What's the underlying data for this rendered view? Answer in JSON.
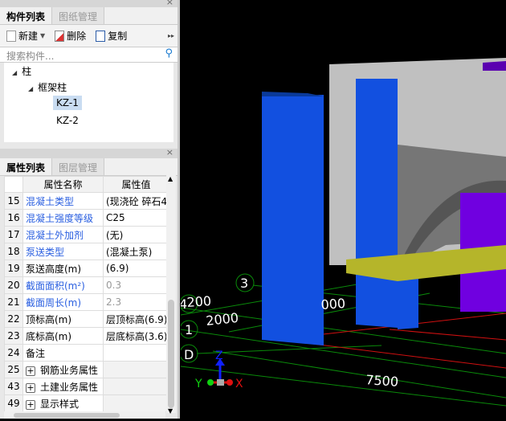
{
  "component_panel": {
    "close": "×",
    "tabs": [
      "构件列表",
      "图纸管理"
    ],
    "toolbar": {
      "new": "新建",
      "delete": "删除",
      "copy": "复制",
      "more": "▸▸"
    },
    "search_placeholder": "搜索构件...",
    "tree": {
      "root": "柱",
      "child": "框架柱",
      "items": [
        "KZ-1",
        "KZ-2"
      ],
      "selected": "KZ-1"
    }
  },
  "property_panel": {
    "close": "×",
    "tabs": [
      "属性列表",
      "图层管理"
    ],
    "headers": [
      "属性名称",
      "属性值"
    ],
    "rows": [
      {
        "no": "15",
        "name": "混凝土类型",
        "value": "(现浇砼 碎石4",
        "style": "blue"
      },
      {
        "no": "16",
        "name": "混凝土强度等级",
        "value": "C25",
        "style": "blue"
      },
      {
        "no": "17",
        "name": "混凝土外加剂",
        "value": "(无)",
        "style": "blue"
      },
      {
        "no": "18",
        "name": "泵送类型",
        "value": "(混凝土泵)",
        "style": "blue"
      },
      {
        "no": "19",
        "name": "泵送高度(m)",
        "value": "(6.9)",
        "style": "normal"
      },
      {
        "no": "20",
        "name": "截面面积(m²)",
        "value": "0.3",
        "style": "blue-gray"
      },
      {
        "no": "21",
        "name": "截面周长(m)",
        "value": "2.3",
        "style": "blue-gray"
      },
      {
        "no": "22",
        "name": "顶标高(m)",
        "value": "层顶标高(6.9)",
        "style": "normal"
      },
      {
        "no": "23",
        "name": "底标高(m)",
        "value": "层底标高(3.6)",
        "style": "normal"
      },
      {
        "no": "24",
        "name": "备注",
        "value": "",
        "style": "normal"
      },
      {
        "no": "25",
        "name": "钢筋业务属性",
        "value": "",
        "style": "group"
      },
      {
        "no": "43",
        "name": "土建业务属性",
        "value": "",
        "style": "group"
      },
      {
        "no": "49",
        "name": "显示样式",
        "value": "",
        "style": "group"
      }
    ]
  },
  "viewport": {
    "axis_labels": [
      "3",
      "1",
      "D",
      "4"
    ],
    "dimensions": [
      "2000",
      "7500",
      "200",
      "000"
    ],
    "axes": {
      "x": "X",
      "y": "Y",
      "z": "Z"
    },
    "colors": {
      "column": "#1250e0",
      "beam": "#b5b52a",
      "slab": "#c0c0c0",
      "wall": "#7000e0",
      "grid": "#0a8a0a",
      "axis_line": "#d01010"
    }
  }
}
